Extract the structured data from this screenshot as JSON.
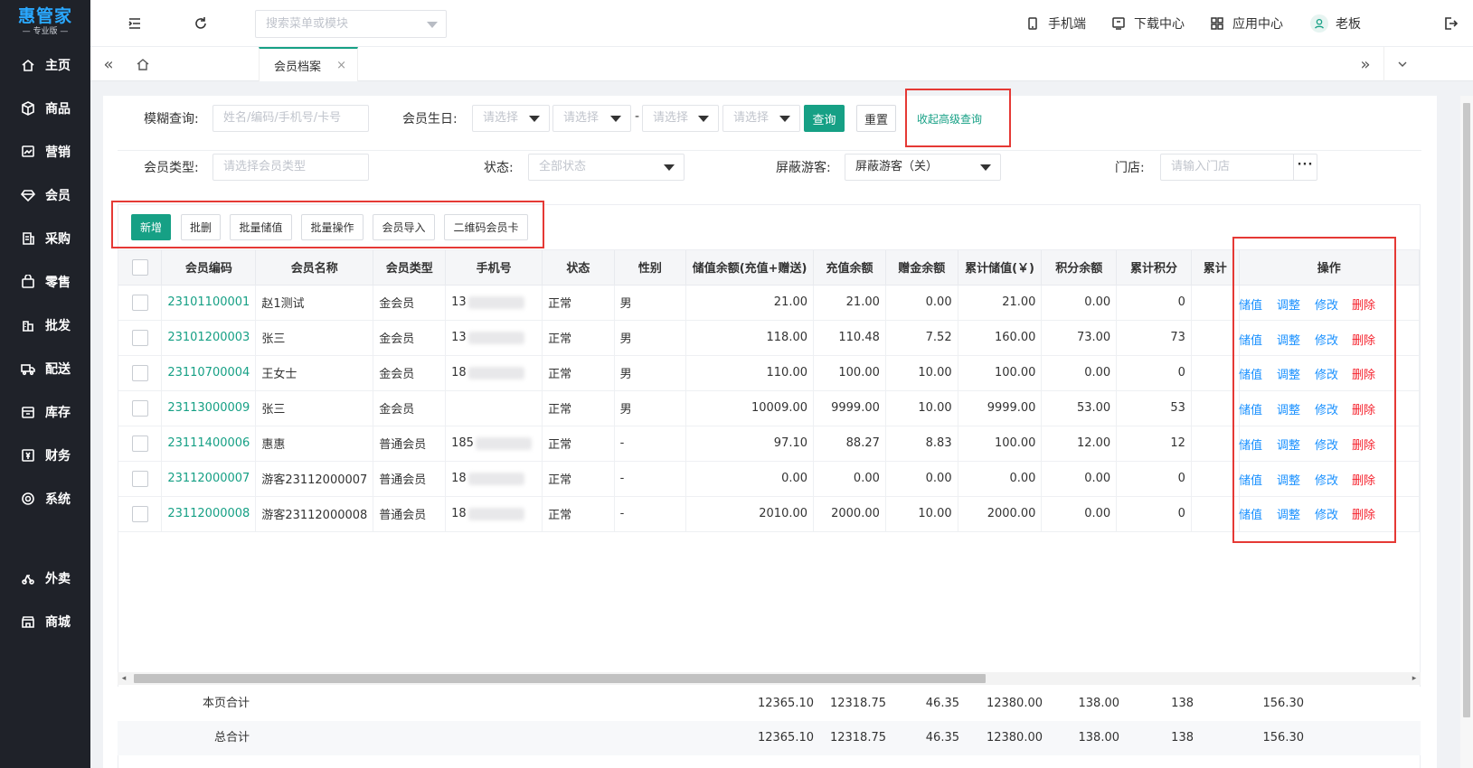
{
  "app": {
    "logo": "惠管家",
    "edition": "专业版",
    "sidebar": [
      {
        "label": "主页",
        "icon": "home-icon"
      },
      {
        "label": "商品",
        "icon": "box-icon"
      },
      {
        "label": "营销",
        "icon": "chart-icon"
      },
      {
        "label": "会员",
        "icon": "diamond-icon"
      },
      {
        "label": "采购",
        "icon": "receipt-icon"
      },
      {
        "label": "零售",
        "icon": "bag-icon"
      },
      {
        "label": "批发",
        "icon": "building-icon"
      },
      {
        "label": "配送",
        "icon": "truck-icon"
      },
      {
        "label": "库存",
        "icon": "inventory-icon"
      },
      {
        "label": "财务",
        "icon": "finance-icon"
      },
      {
        "label": "系统",
        "icon": "settings-icon"
      },
      {
        "label": "外卖",
        "icon": "delivery-icon"
      },
      {
        "label": "商城",
        "icon": "shop-icon"
      }
    ]
  },
  "topbar": {
    "menu_search_placeholder": "搜索菜单或模块",
    "mobile": "手机端",
    "download": "下载中心",
    "apps": "应用中心",
    "user": "老板"
  },
  "tabs": {
    "active": "会员档案",
    "close": "×"
  },
  "filters": {
    "fuzzy_label": "模糊查询:",
    "fuzzy_placeholder": "姓名/编码/手机号/卡号",
    "birthday_label": "会员生日:",
    "select_placeholder": "请选择",
    "range_sep": "-",
    "query_button": "查询",
    "reset_button": "重置",
    "collapse_link": "收起高级查询",
    "type_label": "会员类型:",
    "type_placeholder": "请选择会员类型",
    "status_label": "状态:",
    "status_value": "全部状态",
    "guest_label": "屏蔽游客:",
    "guest_value": "屏蔽游客（关）",
    "store_label": "门店:",
    "store_placeholder": "请输入门店",
    "store_more": "···"
  },
  "toolbar": {
    "add": "新增",
    "batch_delete": "批删",
    "batch_recharge": "批量储值",
    "batch_ops": "批量操作",
    "import": "会员导入",
    "qr_card": "二维码会员卡"
  },
  "table": {
    "columns": [
      "会员编码",
      "会员名称",
      "会员类型",
      "手机号",
      "状态",
      "性别",
      "储值余额(充值+赠送)",
      "充值余额",
      "赠金余额",
      "累计储值(￥)",
      "积分余额",
      "累计积分",
      "累计",
      "操作"
    ],
    "rows": [
      {
        "code": "23101100001",
        "name": "赵1测试",
        "type": "金会员",
        "phone": "13",
        "status": "正常",
        "gender": "男",
        "balance": "21.00",
        "recharge": "21.00",
        "bonus": "0.00",
        "total_stored": "21.00",
        "points": "0.00",
        "total_points": "0"
      },
      {
        "code": "23101200003",
        "name": "张三",
        "type": "金会员",
        "phone": "13",
        "status": "正常",
        "gender": "男",
        "balance": "118.00",
        "recharge": "110.48",
        "bonus": "7.52",
        "total_stored": "160.00",
        "points": "73.00",
        "total_points": "73"
      },
      {
        "code": "23110700004",
        "name": "王女士",
        "type": "金会员",
        "phone": "18",
        "status": "正常",
        "gender": "男",
        "balance": "110.00",
        "recharge": "100.00",
        "bonus": "10.00",
        "total_stored": "100.00",
        "points": "0.00",
        "total_points": "0"
      },
      {
        "code": "23113000009",
        "name": "张三",
        "type": "金会员",
        "phone": "",
        "status": "正常",
        "gender": "男",
        "balance": "10009.00",
        "recharge": "9999.00",
        "bonus": "10.00",
        "total_stored": "9999.00",
        "points": "53.00",
        "total_points": "53"
      },
      {
        "code": "23111400006",
        "name": "惠惠",
        "type": "普通会员",
        "phone": "185",
        "status": "正常",
        "gender": "-",
        "balance": "97.10",
        "recharge": "88.27",
        "bonus": "8.83",
        "total_stored": "100.00",
        "points": "12.00",
        "total_points": "12"
      },
      {
        "code": "23112000007",
        "name": "游客23112000007",
        "type": "普通会员",
        "phone": "18",
        "status": "正常",
        "gender": "-",
        "balance": "0.00",
        "recharge": "0.00",
        "bonus": "0.00",
        "total_stored": "0.00",
        "points": "0.00",
        "total_points": "0"
      },
      {
        "code": "23112000008",
        "name": "游客23112000008",
        "type": "普通会员",
        "phone": "18",
        "status": "正常",
        "gender": "-",
        "balance": "2010.00",
        "recharge": "2000.00",
        "bonus": "10.00",
        "total_stored": "2000.00",
        "points": "0.00",
        "total_points": "0"
      }
    ],
    "actions": {
      "recharge": "储值",
      "adjust": "调整",
      "edit": "修改",
      "delete": "删除"
    },
    "summary": [
      {
        "label": "本页合计",
        "balance": "12365.10",
        "recharge": "12318.75",
        "bonus": "46.35",
        "total_stored": "12380.00",
        "points": "138.00",
        "total_points": "138",
        "extra": "156.30"
      },
      {
        "label": "总合计",
        "balance": "12365.10",
        "recharge": "12318.75",
        "bonus": "46.35",
        "total_stored": "12380.00",
        "points": "138.00",
        "total_points": "138",
        "extra": "156.30"
      }
    ]
  },
  "colors": {
    "accent": "#16a085",
    "link_blue": "#1890ff",
    "danger": "#f5222d",
    "sidebar": "#1f2229",
    "highlight": "#e53935"
  }
}
